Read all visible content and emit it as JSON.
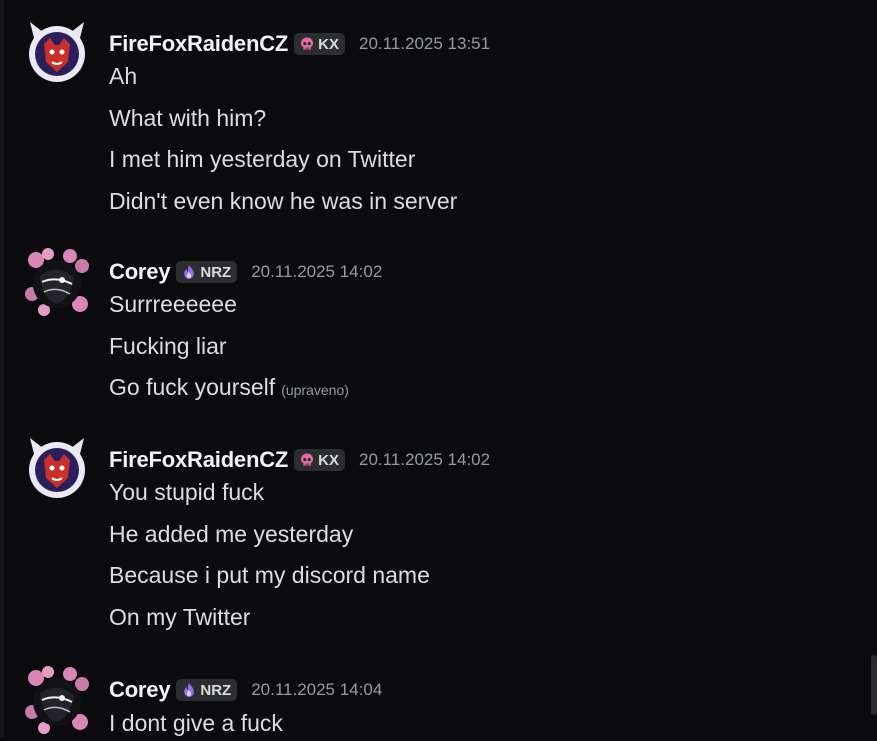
{
  "colors": {
    "background": "#0b0b0e",
    "username": "#f2f3f5",
    "message_text": "#dbdee1",
    "timestamp": "#949ba4",
    "tag_bg": "#2b2d31",
    "kx_skull": "#e56ba2",
    "nrz_flame": "#9b6bf2"
  },
  "messages": [
    {
      "author": "FireFoxRaidenCZ",
      "tag": "KX",
      "tag_icon": "pink-skull-icon",
      "avatar_icon": "red-fox-avatar",
      "timestamp": "20.11.2025 13:51",
      "lines": [
        "Ah",
        "What with him?",
        "I met him yesterday on Twitter",
        "Didn't even know he was in server"
      ]
    },
    {
      "author": "Corey",
      "tag": "NRZ",
      "tag_icon": "purple-flame-icon",
      "avatar_icon": "dark-rose-avatar",
      "timestamp": "20.11.2025 14:02",
      "lines": [
        "Surrreeeeee",
        "Fucking liar",
        "Go fuck yourself"
      ],
      "edited_label": "(upraveno)"
    },
    {
      "author": "FireFoxRaidenCZ",
      "tag": "KX",
      "tag_icon": "pink-skull-icon",
      "avatar_icon": "red-fox-avatar",
      "timestamp": "20.11.2025 14:02",
      "lines": [
        "You stupid fuck",
        "He added me yesterday",
        "Because i put my discord name",
        "On my Twitter"
      ]
    },
    {
      "author": "Corey",
      "tag": "NRZ",
      "tag_icon": "purple-flame-icon",
      "avatar_icon": "dark-rose-avatar",
      "timestamp": "20.11.2025 14:04",
      "lines": [
        "I dont give a fuck"
      ]
    }
  ]
}
